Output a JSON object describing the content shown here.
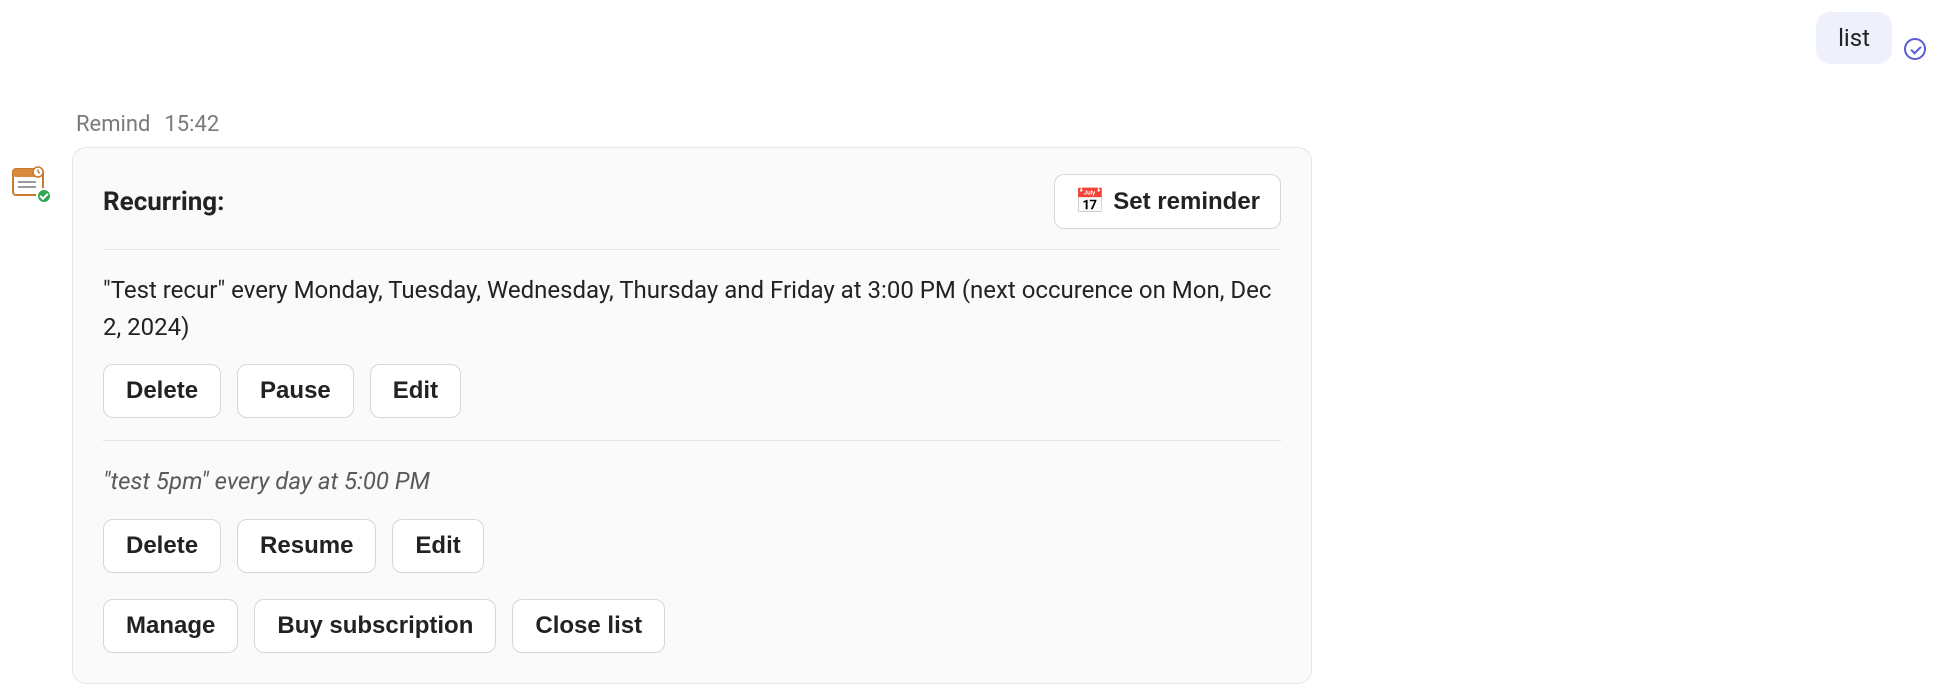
{
  "outgoing": {
    "text": "list"
  },
  "meta": {
    "sender": "Remind",
    "time": "15:42"
  },
  "card": {
    "title": "Recurring:",
    "set_reminder_icon": "📅",
    "set_reminder_label": "Set reminder",
    "items": [
      {
        "description": "\"Test recur\" every Monday, Tuesday, Wednesday, Thursday and Friday at 3:00 PM (next occurence on Mon, Dec 2, 2024)",
        "paused": false,
        "buttons": {
          "delete": "Delete",
          "toggle": "Pause",
          "edit": "Edit"
        }
      },
      {
        "description": "\"test 5pm\" every day at 5:00 PM",
        "paused": true,
        "buttons": {
          "delete": "Delete",
          "toggle": "Resume",
          "edit": "Edit"
        }
      }
    ],
    "footer": {
      "manage": "Manage",
      "buy": "Buy subscription",
      "close": "Close list"
    }
  }
}
